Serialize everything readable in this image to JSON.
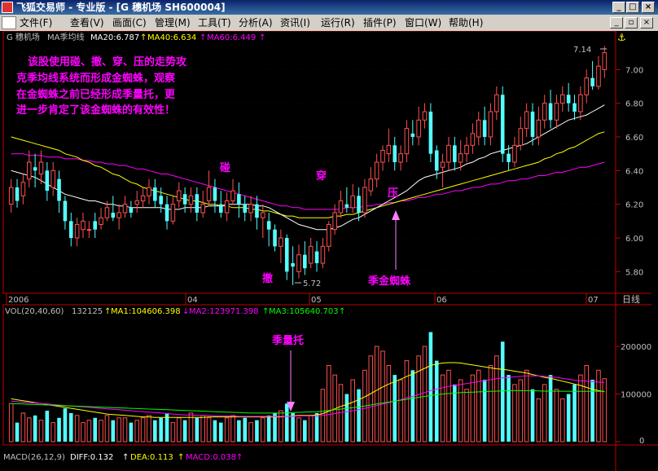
{
  "window": {
    "title": "飞狐交易师 - 专业版 - [G 穗机场 SH600004]",
    "btn_min": "_",
    "btn_max": "□",
    "btn_close": "×"
  },
  "menu": {
    "items": [
      "文件(F)",
      "查看(V)",
      "画面(C)",
      "管理(M)",
      "工具(T)",
      "分析(A)",
      "资讯(I)",
      "运行(R)",
      "插件(P)",
      "窗口(W)",
      "帮助(H)"
    ],
    "ctl_min": "_",
    "ctl_restore": "▫",
    "ctl_close": "×"
  },
  "price_panel": {
    "stock": "G 穗机场",
    "indicator": "MA季均线",
    "ma20": "MA20:6.787",
    "ma40": "MA40:6.634",
    "ma60": "MA60:6.449",
    "y_ticks": [
      "7.00",
      "6.80",
      "6.60",
      "6.40",
      "6.20",
      "6.00",
      "5.80"
    ],
    "high_label": "7.14",
    "low_label": "5.72",
    "note": [
      "该股使用碰、撤、穿、压的走势攻",
      "克季均线系统而形成金蜘蛛，观察",
      "在金蜘蛛之前已经形成季量托，更",
      "进一步肯定了该金蜘蛛的有效性！"
    ],
    "ann_peng": "碰",
    "ann_che": "撤",
    "ann_chuan": "穿",
    "ann_ya": "压",
    "ann_spider": "季金蜘蛛"
  },
  "x_axis": {
    "labels": [
      "2006",
      "04",
      "05",
      "06",
      "07"
    ],
    "period": "日线"
  },
  "volume_panel": {
    "indicator": "VOL(20,40,60)",
    "value": "132125",
    "ma1": "MA1:104606.398",
    "ma2": "MA2:123971.398",
    "ma3": "MA3:105640.703",
    "y_ticks": [
      "200000",
      "100000",
      "0"
    ],
    "ann_tuo": "季量托"
  },
  "macd": {
    "label": "MACD(26,12,9)",
    "diff": "DIFF:0.132",
    "dea": "DEA:0.113",
    "macd": "MACD:0.038"
  },
  "colors": {
    "bg": "#000000",
    "up": "#ff5050",
    "down": "#54ffff",
    "ma20": "#ffffff",
    "ma40": "#ffff00",
    "ma60": "#ff00ff",
    "note": "#ff00ff",
    "axis": "#c00000",
    "text": "#c0c0c0"
  },
  "chart_data": {
    "type": "candlestick",
    "ylim": [
      5.7,
      7.2
    ],
    "candles": [
      [
        6.2,
        6.3,
        6.35,
        6.15
      ],
      [
        6.3,
        6.22,
        6.35,
        6.18
      ],
      [
        6.25,
        6.33,
        6.38,
        6.2
      ],
      [
        6.35,
        6.45,
        6.52,
        6.3
      ],
      [
        6.42,
        6.4,
        6.5,
        6.3
      ],
      [
        6.38,
        6.45,
        6.52,
        6.32
      ],
      [
        6.4,
        6.28,
        6.45,
        6.22
      ],
      [
        6.3,
        6.4,
        6.45,
        6.25
      ],
      [
        6.35,
        6.22,
        6.4,
        6.15
      ],
      [
        6.22,
        6.1,
        6.25,
        6.05
      ],
      [
        6.1,
        6.0,
        6.15,
        5.95
      ],
      [
        6.0,
        6.08,
        6.12,
        5.95
      ],
      [
        6.05,
        6.1,
        6.15,
        6.0
      ],
      [
        6.05,
        6.05,
        6.1,
        6.0
      ],
      [
        6.1,
        6.05,
        6.15,
        6.0
      ],
      [
        6.08,
        6.12,
        6.18,
        6.05
      ],
      [
        6.12,
        6.18,
        6.22,
        6.1
      ],
      [
        6.15,
        6.12,
        6.25,
        6.1
      ],
      [
        6.12,
        6.15,
        6.2,
        6.05
      ],
      [
        6.15,
        6.2,
        6.25,
        6.12
      ],
      [
        6.18,
        6.15,
        6.22,
        6.12
      ],
      [
        6.2,
        6.22,
        6.28,
        6.15
      ],
      [
        6.22,
        6.25,
        6.3,
        6.18
      ],
      [
        6.25,
        6.3,
        6.35,
        6.2
      ],
      [
        6.3,
        6.22,
        6.35,
        6.18
      ],
      [
        6.25,
        6.2,
        6.3,
        6.15
      ],
      [
        6.2,
        6.1,
        6.25,
        6.05
      ],
      [
        6.1,
        6.2,
        6.25,
        6.08
      ],
      [
        6.22,
        6.28,
        6.33,
        6.18
      ],
      [
        6.26,
        6.2,
        6.3,
        6.15
      ],
      [
        6.2,
        6.25,
        6.3,
        6.15
      ],
      [
        6.26,
        6.15,
        6.3,
        6.1
      ],
      [
        6.15,
        6.2,
        6.28,
        6.12
      ],
      [
        6.22,
        6.3,
        6.4,
        6.2
      ],
      [
        6.3,
        6.22,
        6.35,
        6.15
      ],
      [
        6.2,
        6.15,
        6.28,
        6.12
      ],
      [
        6.15,
        6.22,
        6.27,
        6.1
      ],
      [
        6.22,
        6.28,
        6.35,
        6.2
      ],
      [
        6.26,
        6.2,
        6.33,
        6.12
      ],
      [
        6.2,
        6.15,
        6.25,
        6.1
      ],
      [
        6.15,
        6.2,
        6.25,
        6.1
      ],
      [
        6.2,
        6.12,
        6.25,
        6.05
      ],
      [
        6.12,
        6.15,
        6.2,
        6.0
      ],
      [
        6.1,
        6.05,
        6.15,
        5.95
      ],
      [
        6.05,
        5.95,
        6.08,
        5.92
      ],
      [
        5.95,
        6.0,
        6.05,
        5.85
      ],
      [
        6.0,
        5.8,
        6.02,
        5.75
      ],
      [
        5.85,
        5.83,
        5.95,
        5.72
      ],
      [
        5.8,
        5.9,
        5.96,
        5.76
      ],
      [
        5.9,
        5.82,
        5.98,
        5.78
      ],
      [
        5.85,
        5.95,
        6.0,
        5.82
      ],
      [
        5.92,
        5.85,
        5.98,
        5.8
      ],
      [
        5.85,
        5.95,
        6.0,
        5.82
      ],
      [
        5.95,
        6.08,
        6.1,
        5.92
      ],
      [
        6.05,
        6.15,
        6.2,
        6.02
      ],
      [
        6.15,
        6.22,
        6.28,
        6.12
      ],
      [
        6.2,
        6.18,
        6.3,
        6.15
      ],
      [
        6.18,
        6.25,
        6.32,
        6.15
      ],
      [
        6.25,
        6.15,
        6.3,
        6.1
      ],
      [
        6.15,
        6.3,
        6.35,
        6.12
      ],
      [
        6.28,
        6.35,
        6.42,
        6.25
      ],
      [
        6.35,
        6.45,
        6.5,
        6.3
      ],
      [
        6.45,
        6.52,
        6.55,
        6.4
      ],
      [
        6.5,
        6.55,
        6.65,
        6.45
      ],
      [
        6.55,
        6.45,
        6.6,
        6.4
      ],
      [
        6.45,
        6.5,
        6.55,
        6.4
      ],
      [
        6.5,
        6.65,
        6.7,
        6.45
      ],
      [
        6.62,
        6.6,
        6.7,
        6.55
      ],
      [
        6.6,
        6.7,
        6.78,
        6.55
      ],
      [
        6.7,
        6.75,
        6.8,
        6.65
      ],
      [
        6.75,
        6.5,
        6.8,
        6.45
      ],
      [
        6.52,
        6.4,
        6.55,
        6.35
      ],
      [
        6.42,
        6.45,
        6.5,
        6.3
      ],
      [
        6.45,
        6.55,
        6.6,
        6.4
      ],
      [
        6.55,
        6.45,
        6.6,
        6.4
      ],
      [
        6.45,
        6.5,
        6.58,
        6.4
      ],
      [
        6.5,
        6.55,
        6.6,
        6.45
      ],
      [
        6.55,
        6.62,
        6.68,
        6.5
      ],
      [
        6.6,
        6.7,
        6.75,
        6.55
      ],
      [
        6.7,
        6.6,
        6.78,
        6.55
      ],
      [
        6.6,
        6.75,
        6.8,
        6.55
      ],
      [
        6.75,
        6.85,
        6.9,
        6.7
      ],
      [
        6.85,
        6.5,
        6.9,
        6.45
      ],
      [
        6.5,
        6.45,
        6.55,
        6.4
      ],
      [
        6.45,
        6.55,
        6.6,
        6.42
      ],
      [
        6.55,
        6.65,
        6.72,
        6.52
      ],
      [
        6.65,
        6.75,
        6.8,
        6.6
      ],
      [
        6.75,
        6.6,
        6.8,
        6.55
      ],
      [
        6.6,
        6.7,
        6.78,
        6.55
      ],
      [
        6.7,
        6.8,
        6.85,
        6.65
      ],
      [
        6.8,
        6.7,
        6.88,
        6.65
      ],
      [
        6.7,
        6.8,
        6.85,
        6.65
      ],
      [
        6.8,
        6.85,
        6.9,
        6.75
      ],
      [
        6.85,
        6.8,
        6.92,
        6.75
      ],
      [
        6.8,
        6.75,
        6.85,
        6.7
      ],
      [
        6.75,
        6.85,
        6.9,
        6.7
      ],
      [
        6.85,
        6.95,
        7.0,
        6.8
      ],
      [
        6.95,
        6.9,
        7.05,
        6.88
      ],
      [
        6.9,
        7.02,
        7.08,
        6.88
      ],
      [
        7.0,
        7.1,
        7.14,
        6.95
      ]
    ],
    "ma20": [
      6.4,
      6.39,
      6.38,
      6.37,
      6.36,
      6.34,
      6.32,
      6.3,
      6.28,
      6.26,
      6.25,
      6.24,
      6.23,
      6.22,
      6.22,
      6.21,
      6.2,
      6.2,
      6.19,
      6.19,
      6.18,
      6.18,
      6.18,
      6.18,
      6.18,
      6.18,
      6.17,
      6.17,
      6.17,
      6.18,
      6.18,
      6.18,
      6.18,
      6.19,
      6.19,
      6.19,
      6.2,
      6.2,
      6.2,
      6.2,
      6.2,
      6.19,
      6.19,
      6.18,
      6.16,
      6.14,
      6.12,
      6.1,
      6.08,
      6.07,
      6.06,
      6.05,
      6.05,
      6.05,
      6.06,
      6.07,
      6.09,
      6.11,
      6.12,
      6.14,
      6.16,
      6.18,
      6.2,
      6.22,
      6.24,
      6.26,
      6.28,
      6.31,
      6.34,
      6.36,
      6.37,
      6.38,
      6.39,
      6.4,
      6.41,
      6.42,
      6.44,
      6.45,
      6.47,
      6.48,
      6.5,
      6.51,
      6.52,
      6.53,
      6.54,
      6.55,
      6.56,
      6.58,
      6.6,
      6.62,
      6.64,
      6.66,
      6.68,
      6.7,
      6.71,
      6.72,
      6.73,
      6.75,
      6.77,
      6.79
    ],
    "ma40": [
      6.6,
      6.59,
      6.58,
      6.57,
      6.56,
      6.55,
      6.54,
      6.53,
      6.52,
      6.5,
      6.49,
      6.48,
      6.46,
      6.45,
      6.43,
      6.42,
      6.4,
      6.38,
      6.37,
      6.35,
      6.33,
      6.32,
      6.3,
      6.29,
      6.28,
      6.27,
      6.26,
      6.25,
      6.24,
      6.23,
      6.22,
      6.22,
      6.21,
      6.2,
      6.2,
      6.19,
      6.19,
      6.18,
      6.18,
      6.18,
      6.17,
      6.17,
      6.16,
      6.16,
      6.15,
      6.14,
      6.13,
      6.13,
      6.12,
      6.12,
      6.12,
      6.12,
      6.12,
      6.12,
      6.13,
      6.13,
      6.14,
      6.14,
      6.15,
      6.16,
      6.17,
      6.18,
      6.19,
      6.2,
      6.21,
      6.22,
      6.23,
      6.24,
      6.25,
      6.26,
      6.27,
      6.28,
      6.29,
      6.3,
      6.31,
      6.32,
      6.33,
      6.34,
      6.35,
      6.36,
      6.37,
      6.38,
      6.39,
      6.4,
      6.41,
      6.42,
      6.43,
      6.44,
      6.45,
      6.47,
      6.48,
      6.5,
      6.51,
      6.53,
      6.54,
      6.56,
      6.58,
      6.6,
      6.62,
      6.63
    ],
    "ma60": [
      6.5,
      6.5,
      6.5,
      6.49,
      6.49,
      6.49,
      6.48,
      6.48,
      6.48,
      6.47,
      6.47,
      6.47,
      6.46,
      6.46,
      6.45,
      6.45,
      6.44,
      6.44,
      6.43,
      6.43,
      6.42,
      6.41,
      6.41,
      6.4,
      6.39,
      6.38,
      6.38,
      6.37,
      6.36,
      6.35,
      6.34,
      6.33,
      6.32,
      6.31,
      6.3,
      6.29,
      6.28,
      6.27,
      6.26,
      6.25,
      6.24,
      6.23,
      6.22,
      6.21,
      6.2,
      6.19,
      6.19,
      6.18,
      6.18,
      6.17,
      6.17,
      6.17,
      6.17,
      6.17,
      6.17,
      6.17,
      6.18,
      6.18,
      6.18,
      6.19,
      6.19,
      6.2,
      6.2,
      6.21,
      6.21,
      6.22,
      6.22,
      6.23,
      6.24,
      6.24,
      6.25,
      6.26,
      6.26,
      6.27,
      6.28,
      6.28,
      6.29,
      6.3,
      6.3,
      6.31,
      6.32,
      6.32,
      6.33,
      6.34,
      6.34,
      6.35,
      6.35,
      6.36,
      6.37,
      6.37,
      6.38,
      6.39,
      6.39,
      6.4,
      6.41,
      6.42,
      6.42,
      6.43,
      6.44,
      6.45
    ],
    "volume": [
      80000,
      40000,
      60000,
      50000,
      55000,
      45000,
      65000,
      40000,
      50000,
      70000,
      60000,
      55000,
      40000,
      45000,
      50000,
      45000,
      55000,
      45000,
      50000,
      50000,
      40000,
      45000,
      50000,
      55000,
      45000,
      50000,
      60000,
      40000,
      50000,
      45000,
      60000,
      50000,
      55000,
      50000,
      45000,
      40000,
      50000,
      55000,
      45000,
      50000,
      40000,
      45000,
      50000,
      55000,
      60000,
      65000,
      80000,
      60000,
      50000,
      45000,
      55000,
      60000,
      110000,
      160000,
      140000,
      120000,
      100000,
      130000,
      110000,
      150000,
      180000,
      200000,
      190000,
      160000,
      140000,
      130000,
      170000,
      150000,
      180000,
      200000,
      230000,
      170000,
      140000,
      150000,
      120000,
      130000,
      110000,
      140000,
      150000,
      130000,
      160000,
      180000,
      210000,
      140000,
      120000,
      130000,
      150000,
      110000,
      90000,
      120000,
      140000,
      110000,
      90000,
      100000,
      120000,
      140000,
      160000,
      130000,
      150000,
      132125
    ],
    "vol_ma1": [
      90000,
      88000,
      86000,
      84000,
      82000,
      80000,
      78000,
      76000,
      74000,
      72000,
      70000,
      68000,
      66000,
      64000,
      62000,
      60000,
      58000,
      57000,
      56000,
      55000,
      54000,
      53000,
      52000,
      52000,
      51000,
      51000,
      51000,
      51000,
      51000,
      51000,
      51000,
      51000,
      51000,
      52000,
      52000,
      52000,
      52000,
      52000,
      52000,
      52000,
      52000,
      52000,
      52000,
      52000,
      52000,
      52000,
      53000,
      54000,
      55000,
      55000,
      55000,
      56000,
      59000,
      64000,
      69000,
      74000,
      78000,
      83000,
      88000,
      94000,
      101000,
      108000,
      115000,
      121000,
      126000,
      131000,
      137000,
      142000,
      148000,
      154000,
      160000,
      163000,
      165000,
      166000,
      166000,
      165000,
      163000,
      161000,
      159000,
      157000,
      155000,
      153000,
      152000,
      150000,
      148000,
      146000,
      144000,
      141000,
      138000,
      135000,
      133000,
      130000,
      127000,
      124000,
      121000,
      118000,
      114000,
      110000,
      107000,
      104606
    ],
    "vol_ma2": [
      85000,
      84000,
      83000,
      82000,
      81000,
      80000,
      79000,
      78000,
      77000,
      76000,
      75000,
      74000,
      73000,
      72000,
      71000,
      70000,
      69000,
      68000,
      67000,
      66000,
      65000,
      64000,
      63000,
      62000,
      61000,
      60000,
      59000,
      58000,
      57000,
      56000,
      56000,
      55000,
      55000,
      55000,
      54000,
      54000,
      54000,
      54000,
      53000,
      53000,
      53000,
      53000,
      53000,
      53000,
      53000,
      53000,
      53000,
      53000,
      54000,
      54000,
      54000,
      54000,
      55000,
      57000,
      59000,
      61000,
      63000,
      65000,
      67000,
      70000,
      73000,
      76000,
      79000,
      82000,
      85000,
      88000,
      92000,
      95000,
      99000,
      103000,
      107000,
      110000,
      113000,
      116000,
      118000,
      120000,
      122000,
      124000,
      126000,
      128000,
      130000,
      132000,
      134000,
      135000,
      136000,
      137000,
      138000,
      138000,
      138000,
      137000,
      136000,
      135000,
      133000,
      131000,
      129000,
      128000,
      127000,
      126000,
      125000,
      123971
    ],
    "vol_ma3": [
      80000,
      79500,
      79000,
      78500,
      78000,
      77500,
      77000,
      76500,
      76000,
      75500,
      75000,
      74500,
      74000,
      73500,
      73000,
      72500,
      72000,
      71500,
      71000,
      70500,
      70000,
      69500,
      69000,
      68500,
      68000,
      67500,
      67000,
      66500,
      66000,
      65500,
      65000,
      64500,
      64000,
      63500,
      63000,
      62500,
      62000,
      61500,
      61000,
      60500,
      60000,
      60000,
      60000,
      60000,
      60000,
      60000,
      60500,
      61000,
      61500,
      62000,
      62500,
      63000,
      64000,
      65500,
      67000,
      68500,
      70000,
      71500,
      73000,
      75000,
      77000,
      79000,
      81000,
      83000,
      85000,
      87000,
      89000,
      91000,
      93000,
      95000,
      97000,
      98500,
      100000,
      101000,
      102000,
      103000,
      103500,
      104000,
      104500,
      105000,
      105500,
      106000,
      106500,
      107000,
      107000,
      107000,
      107000,
      107000,
      106500,
      106000,
      106000,
      106000,
      105800,
      105800,
      105700,
      105700,
      105700,
      105700,
      105700,
      105640
    ]
  }
}
